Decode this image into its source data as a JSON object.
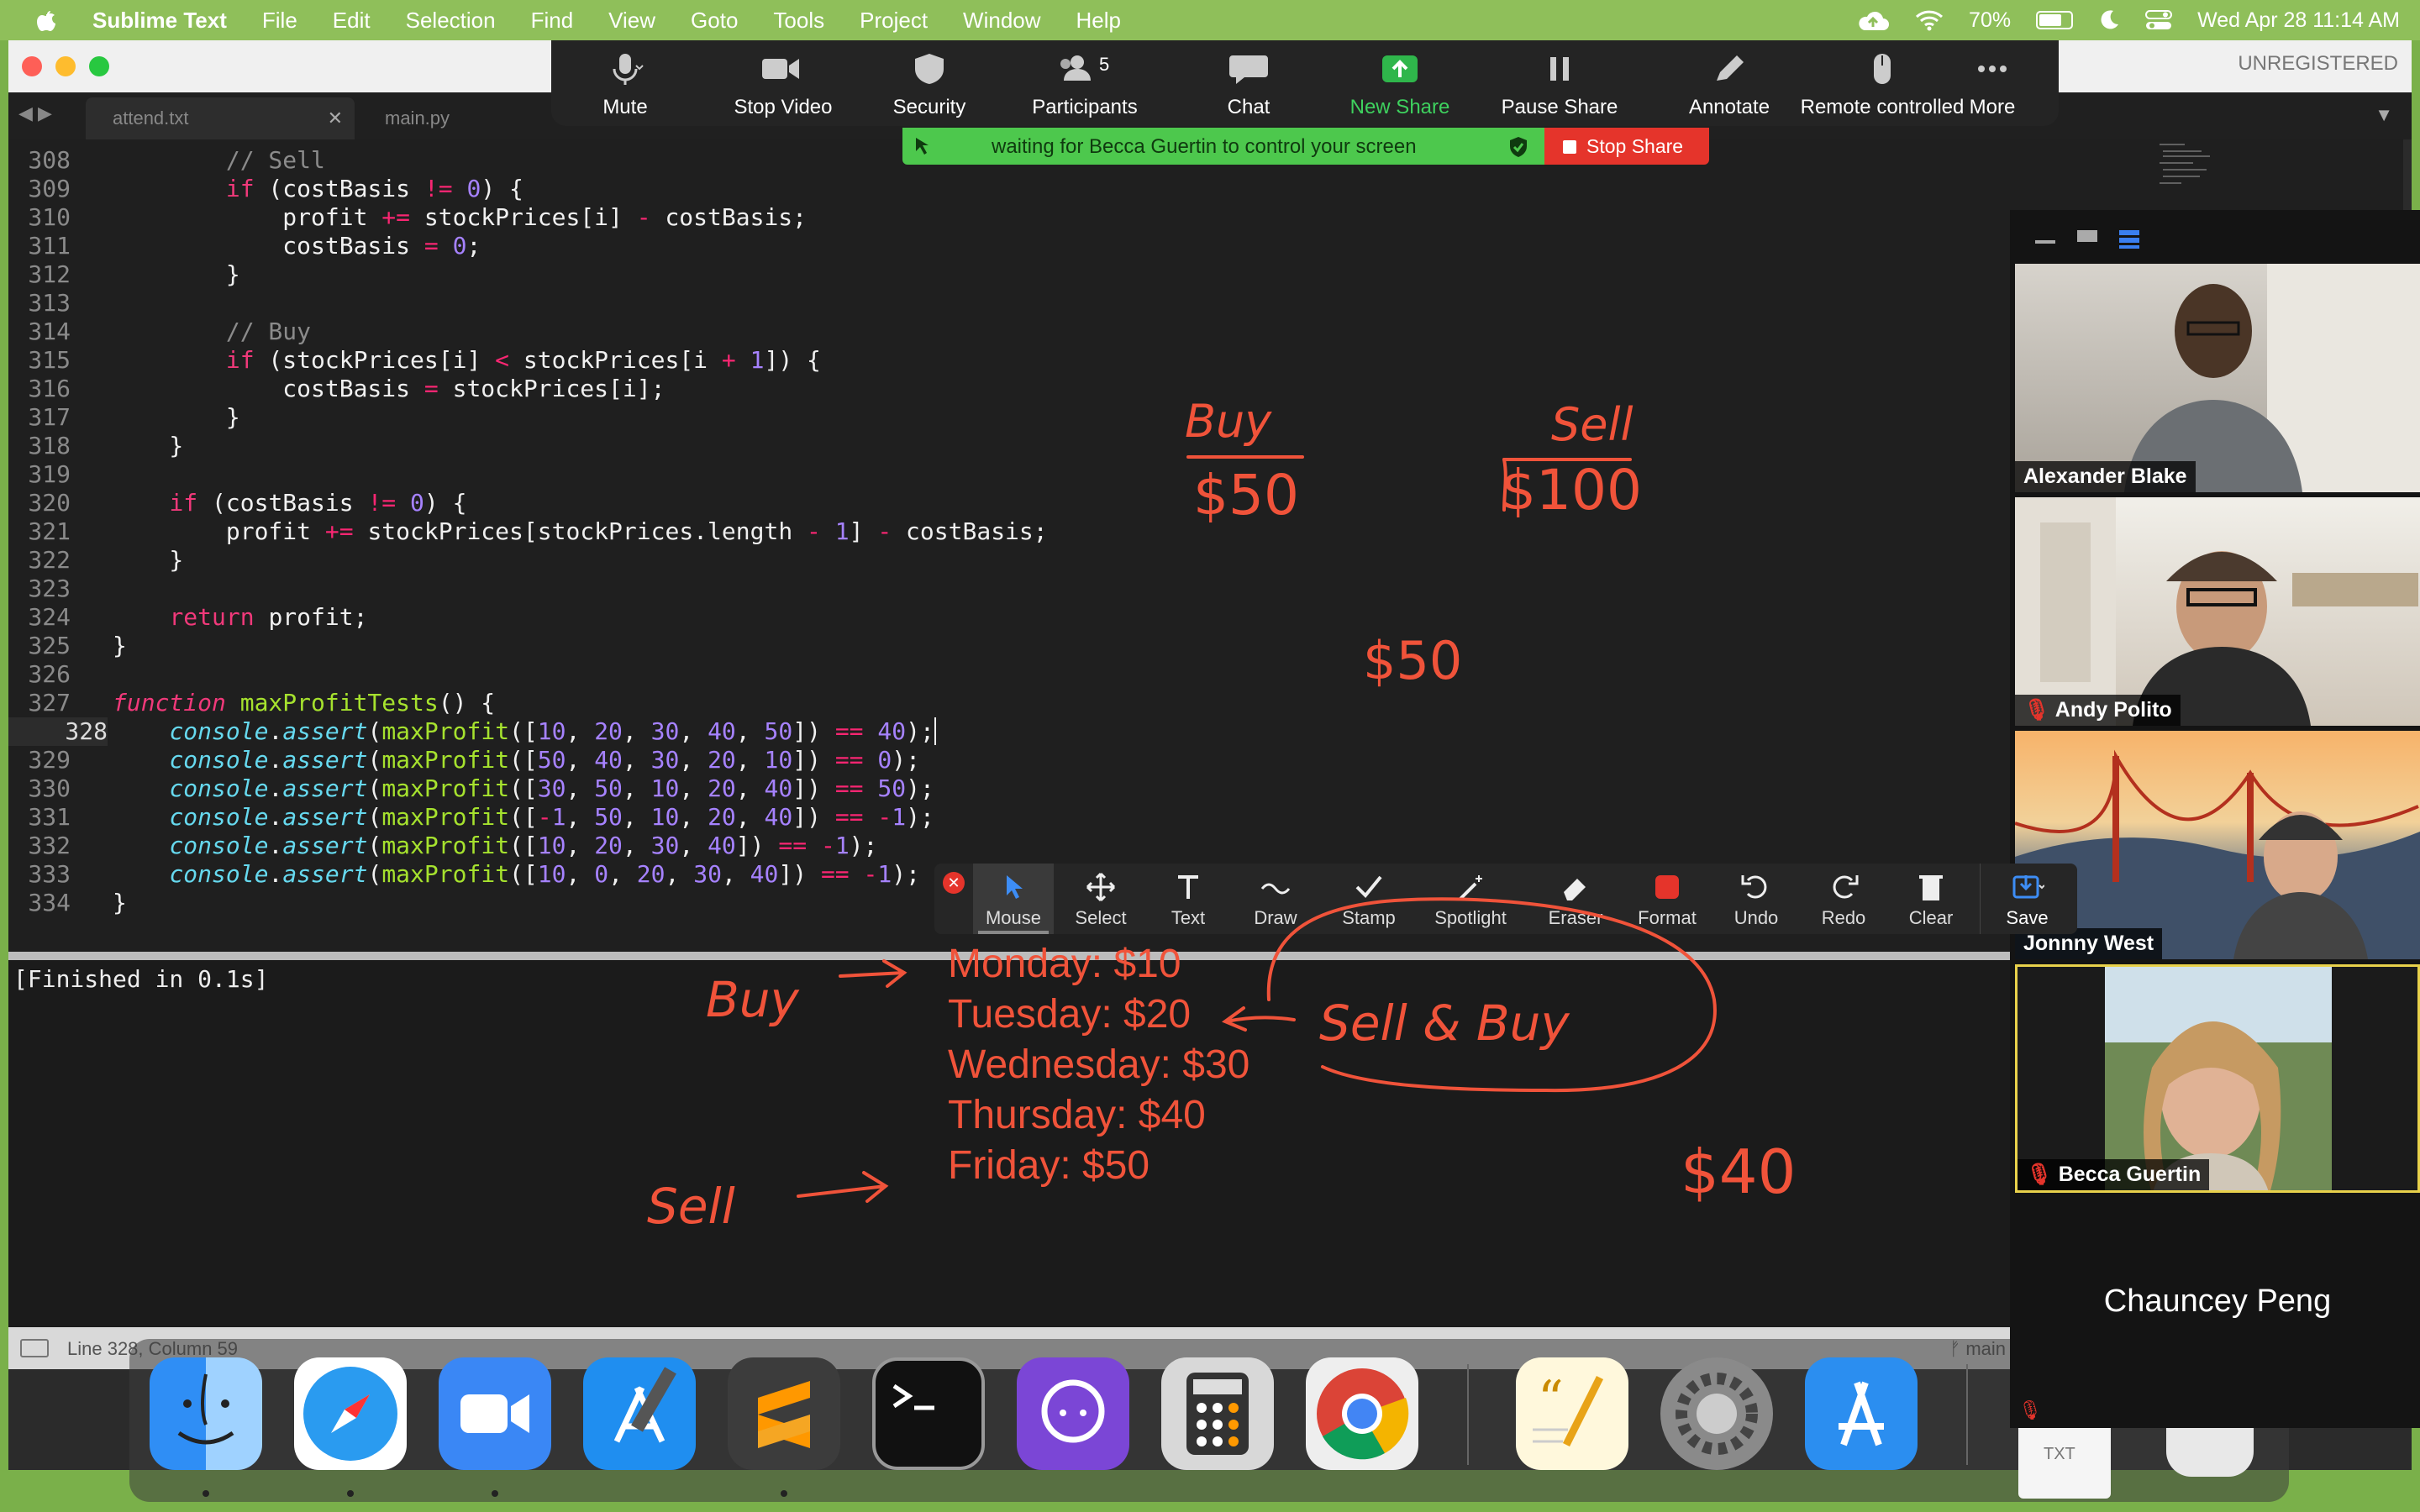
{
  "menubar": {
    "app_name": "Sublime Text",
    "items": [
      "File",
      "Edit",
      "Selection",
      "Find",
      "View",
      "Goto",
      "Tools",
      "Project",
      "Window",
      "Help"
    ],
    "battery": "70%",
    "datetime": "Wed Apr 28  11:14 AM"
  },
  "window": {
    "unregistered": "UNREGISTERED",
    "tabs": [
      "attend.txt",
      "main.py"
    ]
  },
  "zoom_toolbar": {
    "mute": "Mute",
    "stop_video": "Stop Video",
    "security": "Security",
    "participants": "Participants",
    "participants_count": "5",
    "chat": "Chat",
    "new_share": "New Share",
    "pause_share": "Pause Share",
    "annotate": "Annotate",
    "remote_controlled": "Remote controlled",
    "more": "More",
    "waiting_message": "waiting for Becca Guertin to control your screen",
    "stop_share": "Stop Share"
  },
  "editor": {
    "line_numbers": [
      "308",
      "309",
      "310",
      "311",
      "312",
      "313",
      "314",
      "315",
      "316",
      "317",
      "318",
      "319",
      "320",
      "321",
      "322",
      "323",
      "324",
      "325",
      "326",
      "327",
      "328",
      "329",
      "330",
      "331",
      "332",
      "333",
      "334"
    ],
    "output": "[Finished in 0.1s]",
    "status_position": "Line 328, Column 59",
    "branch": "main"
  },
  "annotate_toolbar": {
    "tools": [
      "Mouse",
      "Select",
      "Text",
      "Draw",
      "Stamp",
      "Spotlight",
      "Eraser",
      "Format",
      "Undo",
      "Redo",
      "Clear",
      "Save"
    ]
  },
  "participants": [
    {
      "name": "Alexander Blake"
    },
    {
      "name": "Andy Polito"
    },
    {
      "name": "Jonnny West"
    },
    {
      "name": "Becca Guertin"
    },
    {
      "name": "Chauncey Peng"
    }
  ],
  "annotations": {
    "days": [
      "Monday: $10",
      "Tuesday: $20",
      "Wednesday: $30",
      "Thursday: $40",
      "Friday: $50"
    ],
    "hand_buy_top": "Buy",
    "hand_50_top": "$50",
    "hand_sell_top": "Sell",
    "hand_100": "$100",
    "hand_50_mid": "$50",
    "hand_buy_left": "Buy",
    "hand_sell_left": "Sell",
    "hand_sell_buy": "Sell & Buy",
    "hand_40": "$40"
  },
  "dock": {
    "extra_label": "TXT"
  },
  "colors": {
    "annotation": "#f0533a",
    "desktop": "#7ab04a",
    "share_green": "#4dc84d",
    "stop_red": "#e5342b"
  }
}
